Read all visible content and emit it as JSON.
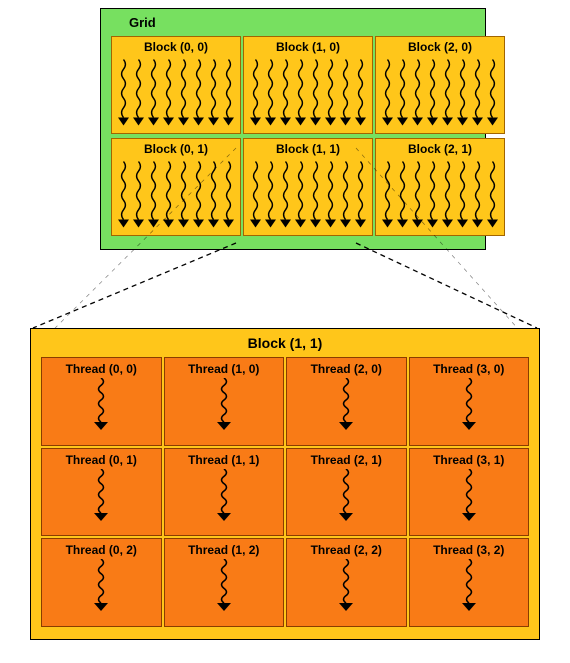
{
  "grid": {
    "title": "Grid",
    "blocks": [
      {
        "label": "Block (0, 0)"
      },
      {
        "label": "Block (1, 0)"
      },
      {
        "label": "Block (2, 0)"
      },
      {
        "label": "Block (0, 1)"
      },
      {
        "label": "Block (1, 1)"
      },
      {
        "label": "Block (2, 1)"
      }
    ],
    "cols": 3,
    "rows": 2
  },
  "detail": {
    "title": "Block (1, 1)",
    "threads": [
      {
        "label": "Thread (0, 0)"
      },
      {
        "label": "Thread (1, 0)"
      },
      {
        "label": "Thread (2, 0)"
      },
      {
        "label": "Thread (3, 0)"
      },
      {
        "label": "Thread (0, 1)"
      },
      {
        "label": "Thread (1, 1)"
      },
      {
        "label": "Thread (2, 1)"
      },
      {
        "label": "Thread (3, 1)"
      },
      {
        "label": "Thread (0, 2)"
      },
      {
        "label": "Thread (1, 2)"
      },
      {
        "label": "Thread (2, 2)"
      },
      {
        "label": "Thread (3, 2)"
      }
    ],
    "cols": 4,
    "rows": 3
  },
  "colors": {
    "grid_bg": "#77e060",
    "block_bg": "#ffc61a",
    "thread_bg": "#f97b16"
  }
}
